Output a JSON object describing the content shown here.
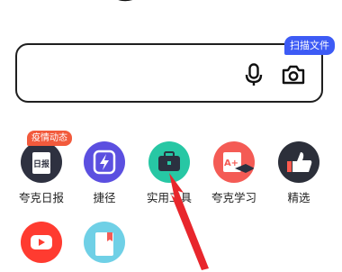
{
  "search": {
    "scan_badge": "扫描文件"
  },
  "apps": [
    {
      "label": "夸克日报",
      "badge": "疫情动态",
      "icon": "daily-news-icon",
      "color": "#2e3140"
    },
    {
      "label": "捷径",
      "icon": "lightning-icon",
      "color": "#5b4fe0"
    },
    {
      "label": "实用工具",
      "icon": "toolbox-icon",
      "color": "#27c7a4"
    },
    {
      "label": "夸克学习",
      "icon": "graduation-cap-icon",
      "color": "#f45b55"
    },
    {
      "label": "精选",
      "icon": "thumbs-up-icon",
      "color": "#2c2f3a"
    },
    {
      "label": "",
      "icon": "video-play-icon",
      "color": "#ff3b30"
    },
    {
      "label": "",
      "icon": "book-icon",
      "color": "#6fd0e6"
    }
  ]
}
